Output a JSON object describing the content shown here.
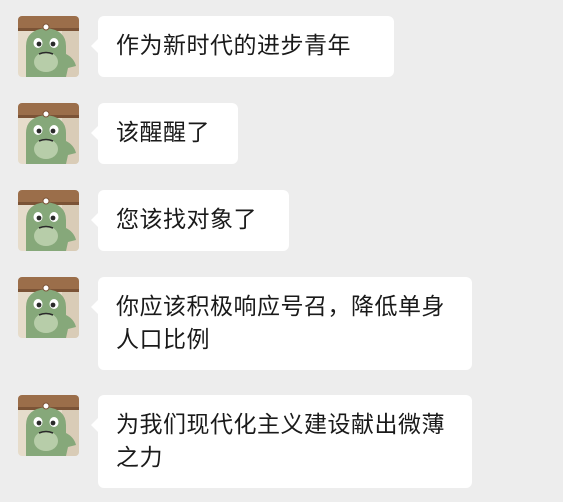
{
  "chat": {
    "messages": [
      {
        "avatar": "frog-avatar-icon",
        "text": "作为新时代的进步青年"
      },
      {
        "avatar": "frog-avatar-icon",
        "text": "该醒醒了"
      },
      {
        "avatar": "frog-avatar-icon",
        "text": "您该找对象了"
      },
      {
        "avatar": "frog-avatar-icon",
        "text": "你应该积极响应号召，降低单身人口比例"
      },
      {
        "avatar": "frog-avatar-icon",
        "text": "为我们现代化主义建设献出微薄之力"
      }
    ]
  },
  "colors": {
    "background": "#ededed",
    "bubble": "#ffffff",
    "text": "#1a1a1a",
    "frog_green": "#86a87a",
    "avatar_bg": "#e6dccb",
    "wood": "#9b6e4a"
  }
}
